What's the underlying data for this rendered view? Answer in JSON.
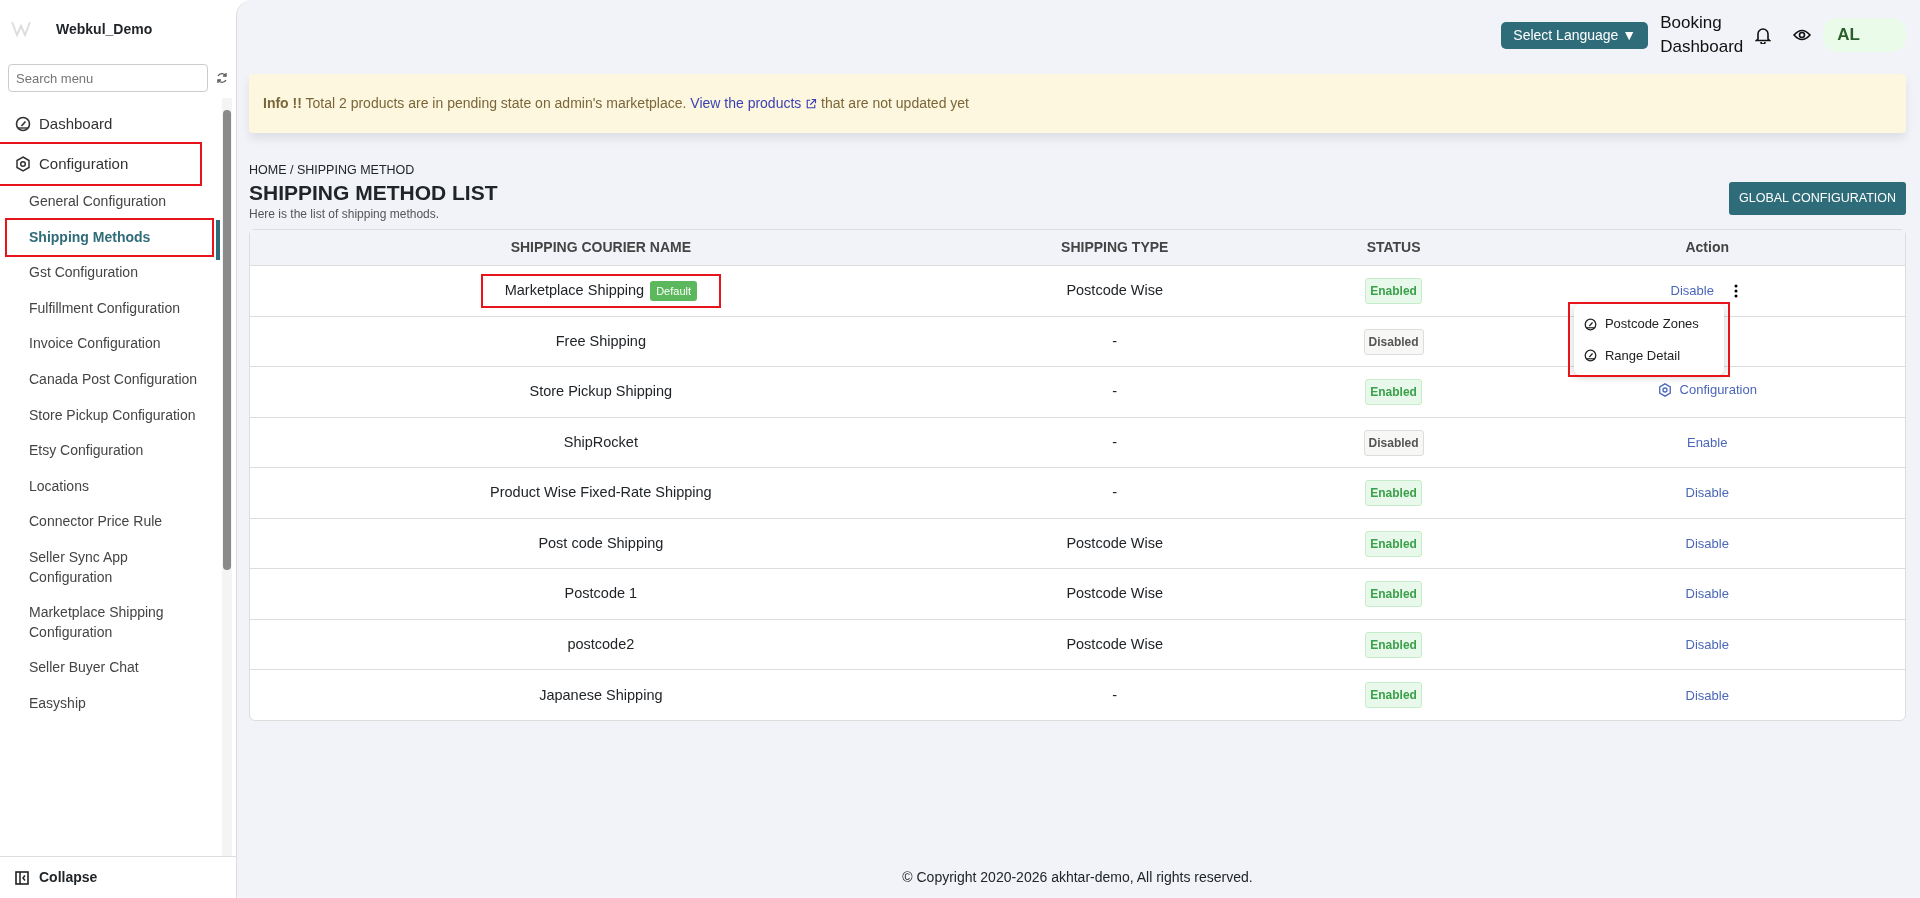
{
  "sidebar": {
    "brand": "Webkul_Demo",
    "search": {
      "placeholder": "Search menu"
    },
    "items": [
      {
        "label": "Dashboard",
        "highlighted": false
      },
      {
        "label": "Configuration",
        "highlighted": true,
        "children": [
          {
            "label": "General Configuration",
            "selected": false,
            "highlighted": false
          },
          {
            "label": "Shipping Methods",
            "selected": true,
            "highlighted": true
          },
          {
            "label": "Gst Configuration",
            "selected": false,
            "highlighted": false
          },
          {
            "label": "Fulfillment Configuration",
            "selected": false,
            "highlighted": false
          },
          {
            "label": "Invoice Configuration",
            "selected": false,
            "highlighted": false
          },
          {
            "label": "Canada Post Configuration",
            "selected": false,
            "highlighted": false
          },
          {
            "label": "Store Pickup Configuration",
            "selected": false,
            "highlighted": false
          },
          {
            "label": "Etsy Configuration",
            "selected": false,
            "highlighted": false
          },
          {
            "label": "Locations",
            "selected": false,
            "highlighted": false
          },
          {
            "label": "Connector Price Rule",
            "selected": false,
            "highlighted": false
          },
          {
            "label": "Seller Sync App Configuration",
            "selected": false,
            "highlighted": false
          },
          {
            "label": "Marketplace Shipping Configuration",
            "selected": false,
            "highlighted": false
          },
          {
            "label": "Seller Buyer Chat",
            "selected": false,
            "highlighted": false
          },
          {
            "label": "Easyship",
            "selected": false,
            "highlighted": false
          }
        ]
      }
    ],
    "collapse": "Collapse"
  },
  "header": {
    "language_button": "Select Language",
    "language_caret": "▼",
    "booking_link": "Booking Dashboard",
    "avatar": "AL"
  },
  "alert": {
    "text": "**Info !!** Total 2 products are in pending state on admin's marketplace.",
    "link": "View the products",
    "after": "that are not updated yet"
  },
  "page": {
    "breadcrumb": "HOME / SHIPPING METHOD",
    "title": "SHIPPING METHOD LIST",
    "subtitle": "Here is the list of shipping methods.",
    "global_button": "GLOBAL CONFIGURATION"
  },
  "table": {
    "columns": [
      "SHIPPING COURIER NAME",
      "SHIPPING TYPE",
      "STATUS",
      "Action"
    ],
    "rows": [
      {
        "name": "Marketplace Shipping",
        "badge": "Default",
        "highlighted": true,
        "type": "Postcode Wise",
        "status": "Enabled",
        "enabled": true,
        "action": {
          "kind": "link",
          "label": "Disable",
          "more": true,
          "menu": {
            "highlighted": true,
            "items": [
              "Postcode Zones",
              "Range Detail"
            ]
          }
        }
      },
      {
        "name": "Free Shipping",
        "highlighted": false,
        "type": "-",
        "status": "Disabled",
        "enabled": false
      },
      {
        "name": "Store Pickup Shipping",
        "highlighted": false,
        "type": "-",
        "status": "Enabled",
        "enabled": true,
        "action": {
          "kind": "config",
          "label": "Configuration",
          "more": false
        }
      },
      {
        "name": "ShipRocket",
        "highlighted": false,
        "type": "-",
        "status": "Disabled",
        "enabled": false,
        "action": {
          "kind": "link",
          "label": "Enable",
          "more": false
        }
      },
      {
        "name": "Product Wise Fixed-Rate Shipping",
        "highlighted": false,
        "type": "-",
        "status": "Enabled",
        "enabled": true,
        "action": {
          "kind": "link",
          "label": "Disable",
          "more": false
        }
      },
      {
        "name": "Post code Shipping",
        "highlighted": false,
        "type": "Postcode Wise",
        "status": "Enabled",
        "enabled": true,
        "action": {
          "kind": "link",
          "label": "Disable",
          "more": false
        }
      },
      {
        "name": "Postcode 1",
        "highlighted": false,
        "type": "Postcode Wise",
        "status": "Enabled",
        "enabled": true,
        "action": {
          "kind": "link",
          "label": "Disable",
          "more": false
        }
      },
      {
        "name": "postcode2",
        "highlighted": false,
        "type": "Postcode Wise",
        "status": "Enabled",
        "enabled": true,
        "action": {
          "kind": "link",
          "label": "Disable",
          "more": false
        }
      },
      {
        "name": "Japanese Shipping",
        "highlighted": false,
        "type": "-",
        "status": "Enabled",
        "enabled": true,
        "action": {
          "kind": "link",
          "label": "Disable",
          "more": false
        }
      }
    ]
  },
  "footer": "© Copyright 2020-2026 akhtar-demo, All rights reserved."
}
